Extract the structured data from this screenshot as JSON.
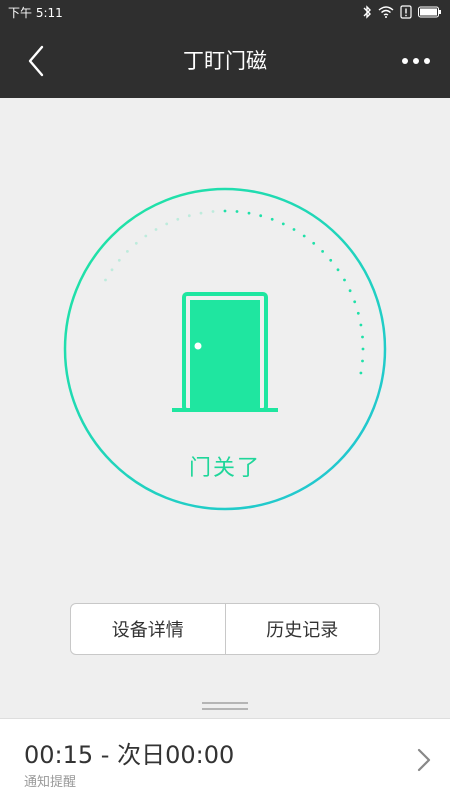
{
  "status_bar": {
    "time": "下午 5:11",
    "icons": [
      "bluetooth-icon",
      "wifi-icon",
      "alert-icon",
      "battery-icon"
    ]
  },
  "header": {
    "title": "丁盯门磁",
    "back_icon": "chevron-left-icon",
    "menu_icon": "more-icon"
  },
  "door": {
    "state_text": "门关了",
    "icon": "door-icon",
    "accent_color": "#1fe6a0",
    "ring_color_end": "#22c3d6"
  },
  "buttons": {
    "details": "设备详情",
    "history": "历史记录"
  },
  "schedule": {
    "time_range": "00:15 - 次日00:00",
    "label": "通知提醒"
  }
}
